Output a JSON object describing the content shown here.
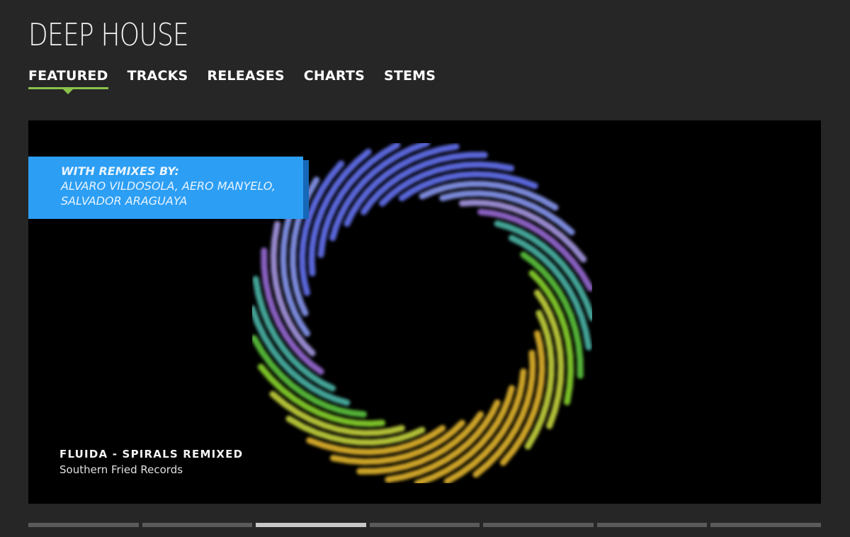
{
  "header": {
    "title": "DEEP HOUSE"
  },
  "tabs": [
    {
      "label": "FEATURED",
      "active": true
    },
    {
      "label": "TRACKS",
      "active": false
    },
    {
      "label": "RELEASES",
      "active": false
    },
    {
      "label": "CHARTS",
      "active": false
    },
    {
      "label": "STEMS",
      "active": false
    }
  ],
  "hero": {
    "banner_heading": "WITH REMIXES BY:",
    "banner_artists": "ALVARO VILDOSOLA, AERO MANYELO, SALVADOR ARAGUAYA",
    "release_title": "FLUIDA - SPIRALS REMIXED",
    "release_label": "Southern Fried Records",
    "accent_color": "#2c9ef4"
  },
  "carousel": {
    "slide_count": 7,
    "active_index": 2
  },
  "colors": {
    "background": "#262626",
    "tab_underline": "#8bc34a",
    "hero_background": "#000000"
  }
}
